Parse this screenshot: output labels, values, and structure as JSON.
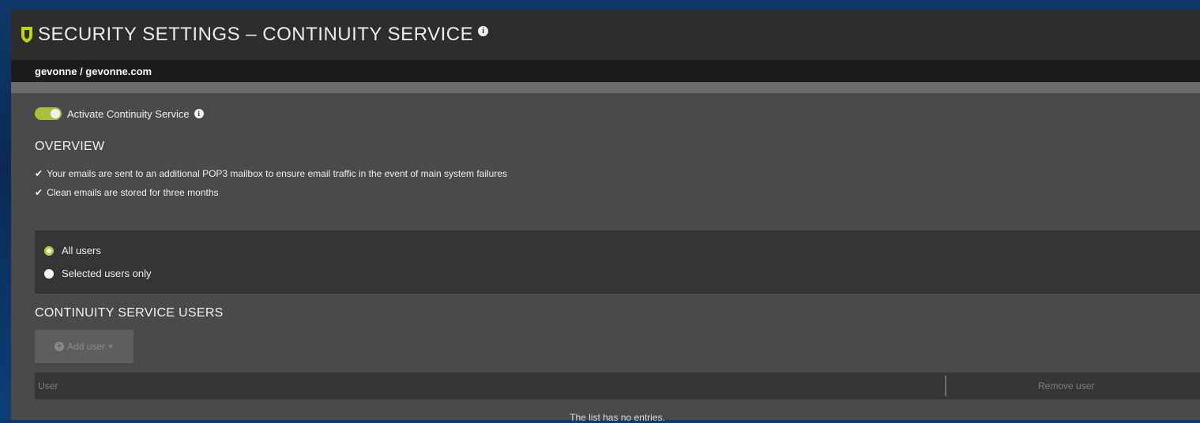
{
  "header": {
    "title": "SECURITY SETTINGS – CONTINUITY SERVICE",
    "info_icon": "info-icon",
    "shield_color": "#c4d600"
  },
  "breadcrumb": "gevonne / gevonne.com",
  "activation": {
    "label": "Activate Continuity Service",
    "enabled": true,
    "toggle_color": "#a9c23a"
  },
  "overview": {
    "heading": "OVERVIEW",
    "items": [
      "Your emails are sent to an additional POP3 mailbox to ensure email traffic in the event of main system failures",
      "Clean emails are stored for three months"
    ]
  },
  "user_scope": {
    "options": [
      {
        "label": "All users",
        "selected": true
      },
      {
        "label": "Selected users only",
        "selected": false
      }
    ]
  },
  "users_section": {
    "heading": "CONTINUITY SERVICE USERS",
    "add_button": "Add user",
    "columns": [
      "User",
      "Remove user"
    ],
    "empty_message": "The list has no entries."
  }
}
